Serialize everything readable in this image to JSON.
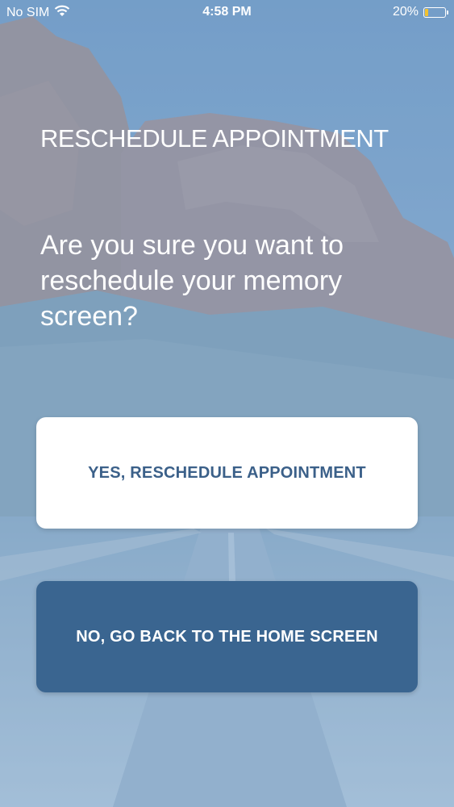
{
  "status_bar": {
    "carrier": "No SIM",
    "time": "4:58 PM",
    "battery_percent": "20%",
    "battery_level": 0.2,
    "wifi_icon": "wifi-icon",
    "battery_icon": "battery-icon"
  },
  "screen": {
    "title": "RESCHEDULE APPOINTMENT",
    "question": "Are you sure you want to reschedule your memory screen?"
  },
  "buttons": {
    "confirm_label": "YES, RESCHEDULE APPOINTMENT",
    "cancel_label": "NO, GO BACK TO THE HOME SCREEN"
  },
  "colors": {
    "primary": "#3a6590",
    "confirm_text": "#3b6089",
    "overlay": "#7ea3c8",
    "battery": "#f2c230"
  }
}
